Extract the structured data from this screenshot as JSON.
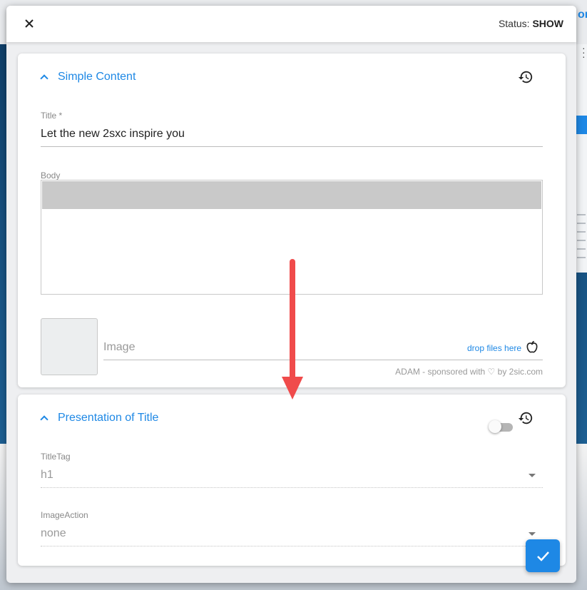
{
  "header": {
    "close_icon": "close-icon",
    "status_label": "Status:",
    "status_value": "SHOW"
  },
  "background": {
    "topright_text": "ort"
  },
  "card_simple_content": {
    "section_title": "Simple Content",
    "title_label": "Title *",
    "title_value": "Let the new 2sxc inspire you",
    "body_label": "Body",
    "image_label": "Image",
    "drop_files": "drop files here",
    "adam_note": "ADAM - sponsored with ♡ by 2sic.com"
  },
  "card_presentation": {
    "section_title": "Presentation of Title",
    "toggle_on": false,
    "title_tag_label": "TitleTag",
    "title_tag_value": "h1",
    "image_action_label": "ImageAction",
    "image_action_value": "none"
  },
  "colors": {
    "accent": "#1e88e5",
    "annotation_arrow": "#f04b4b"
  },
  "icons": [
    "close-icon",
    "chevron-up-icon",
    "history-icon",
    "apple-icon",
    "toggle-switch",
    "dropdown-arrow-icon",
    "check-icon",
    "down-arrow-annotation"
  ]
}
